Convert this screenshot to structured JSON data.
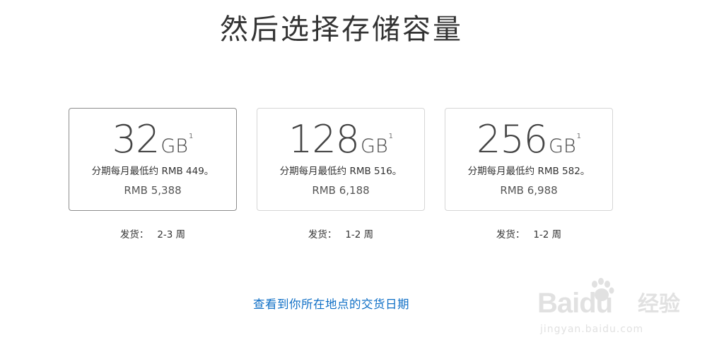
{
  "page": {
    "title": "然后选择存储容量"
  },
  "options": [
    {
      "capacity": "32",
      "unit": "GB",
      "footnote": "1",
      "installment": "分期每月最低约 RMB 449。",
      "price": "RMB 5,388",
      "shipping_label": "发货：",
      "shipping_value": "2-3 周",
      "selected": true
    },
    {
      "capacity": "128",
      "unit": "GB",
      "footnote": "1",
      "installment": "分期每月最低约 RMB 516。",
      "price": "RMB 6,188",
      "shipping_label": "发货：",
      "shipping_value": "1-2 周",
      "selected": false
    },
    {
      "capacity": "256",
      "unit": "GB",
      "footnote": "1",
      "installment": "分期每月最低约 RMB 582。",
      "price": "RMB 6,988",
      "shipping_label": "发货：",
      "shipping_value": "1-2 周",
      "selected": false
    }
  ],
  "delivery_link": {
    "label": "查看到你所在地点的交货日期",
    "color": "#0f6fc6"
  },
  "watermark": {
    "brand_prefix": "Bai",
    "brand_suffix": "du",
    "brand_cn": "经验",
    "url": "jingyan.baidu.com",
    "icon": "paw-icon"
  },
  "colors": {
    "selected_border": "#8d8d8d",
    "card_border": "#d6d6d6",
    "text": "#333333"
  }
}
